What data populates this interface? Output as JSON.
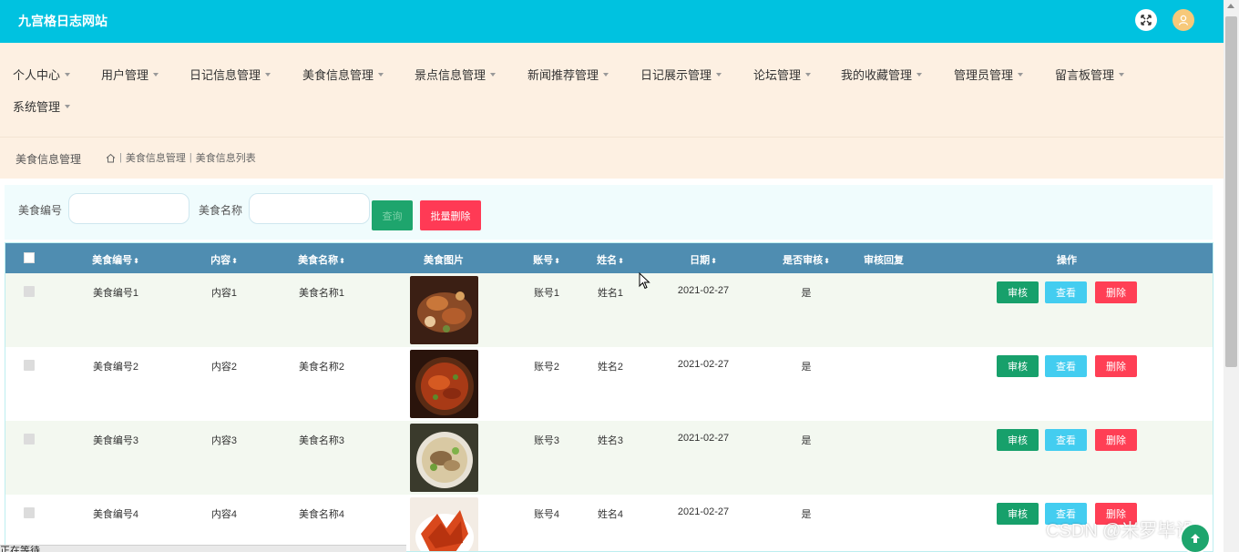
{
  "header": {
    "title": "九宫格日志网站"
  },
  "nav": {
    "items": [
      {
        "label": "个人中心"
      },
      {
        "label": "用户管理"
      },
      {
        "label": "日记信息管理"
      },
      {
        "label": "美食信息管理"
      },
      {
        "label": "景点信息管理"
      },
      {
        "label": "新闻推荐管理"
      },
      {
        "label": "日记展示管理"
      },
      {
        "label": "论坛管理"
      },
      {
        "label": "我的收藏管理"
      },
      {
        "label": "管理员管理"
      },
      {
        "label": "留言板管理"
      },
      {
        "label": "系统管理"
      }
    ]
  },
  "breadcrumb": {
    "section_title": "美食信息管理",
    "crumbs": [
      "美食信息管理",
      "美食信息列表"
    ],
    "separator": "|"
  },
  "search": {
    "field1_label": "美食编号",
    "field1_value": "",
    "field2_label": "美食名称",
    "field2_value": "",
    "search_button": "查询",
    "batch_delete_button": "批量删除"
  },
  "table": {
    "headers": {
      "code": "美食编号",
      "content": "内容",
      "name": "美食名称",
      "image": "美食图片",
      "account": "账号",
      "person": "姓名",
      "date": "日期",
      "approved": "是否审核",
      "reply": "审核回复",
      "actions": "操作"
    },
    "sort_glyph": "⬍",
    "rows": [
      {
        "code": "美食编号1",
        "content": "内容1",
        "name": "美食名称1",
        "account": "账号1",
        "person": "姓名1",
        "date": "2021-02-27",
        "approved": "是",
        "reply": ""
      },
      {
        "code": "美食编号2",
        "content": "内容2",
        "name": "美食名称2",
        "account": "账号2",
        "person": "姓名2",
        "date": "2021-02-27",
        "approved": "是",
        "reply": ""
      },
      {
        "code": "美食编号3",
        "content": "内容3",
        "name": "美食名称3",
        "account": "账号3",
        "person": "姓名3",
        "date": "2021-02-27",
        "approved": "是",
        "reply": ""
      },
      {
        "code": "美食编号4",
        "content": "内容4",
        "name": "美食名称4",
        "account": "账号4",
        "person": "姓名4",
        "date": "2021-02-27",
        "approved": "是",
        "reply": ""
      }
    ],
    "action_labels": {
      "audit": "审核",
      "view": "查看",
      "delete": "删除"
    }
  },
  "status_bar": {
    "text": "正在等待 ..."
  },
  "watermark": {
    "text": "CSDN @米罗毕设"
  },
  "colors": {
    "header": "#00c2e0",
    "nav_bg": "#fdf0e2",
    "table_header": "#4f8db1",
    "audit": "#17a06b",
    "view": "#43cdf0",
    "delete": "#ff3f55"
  }
}
